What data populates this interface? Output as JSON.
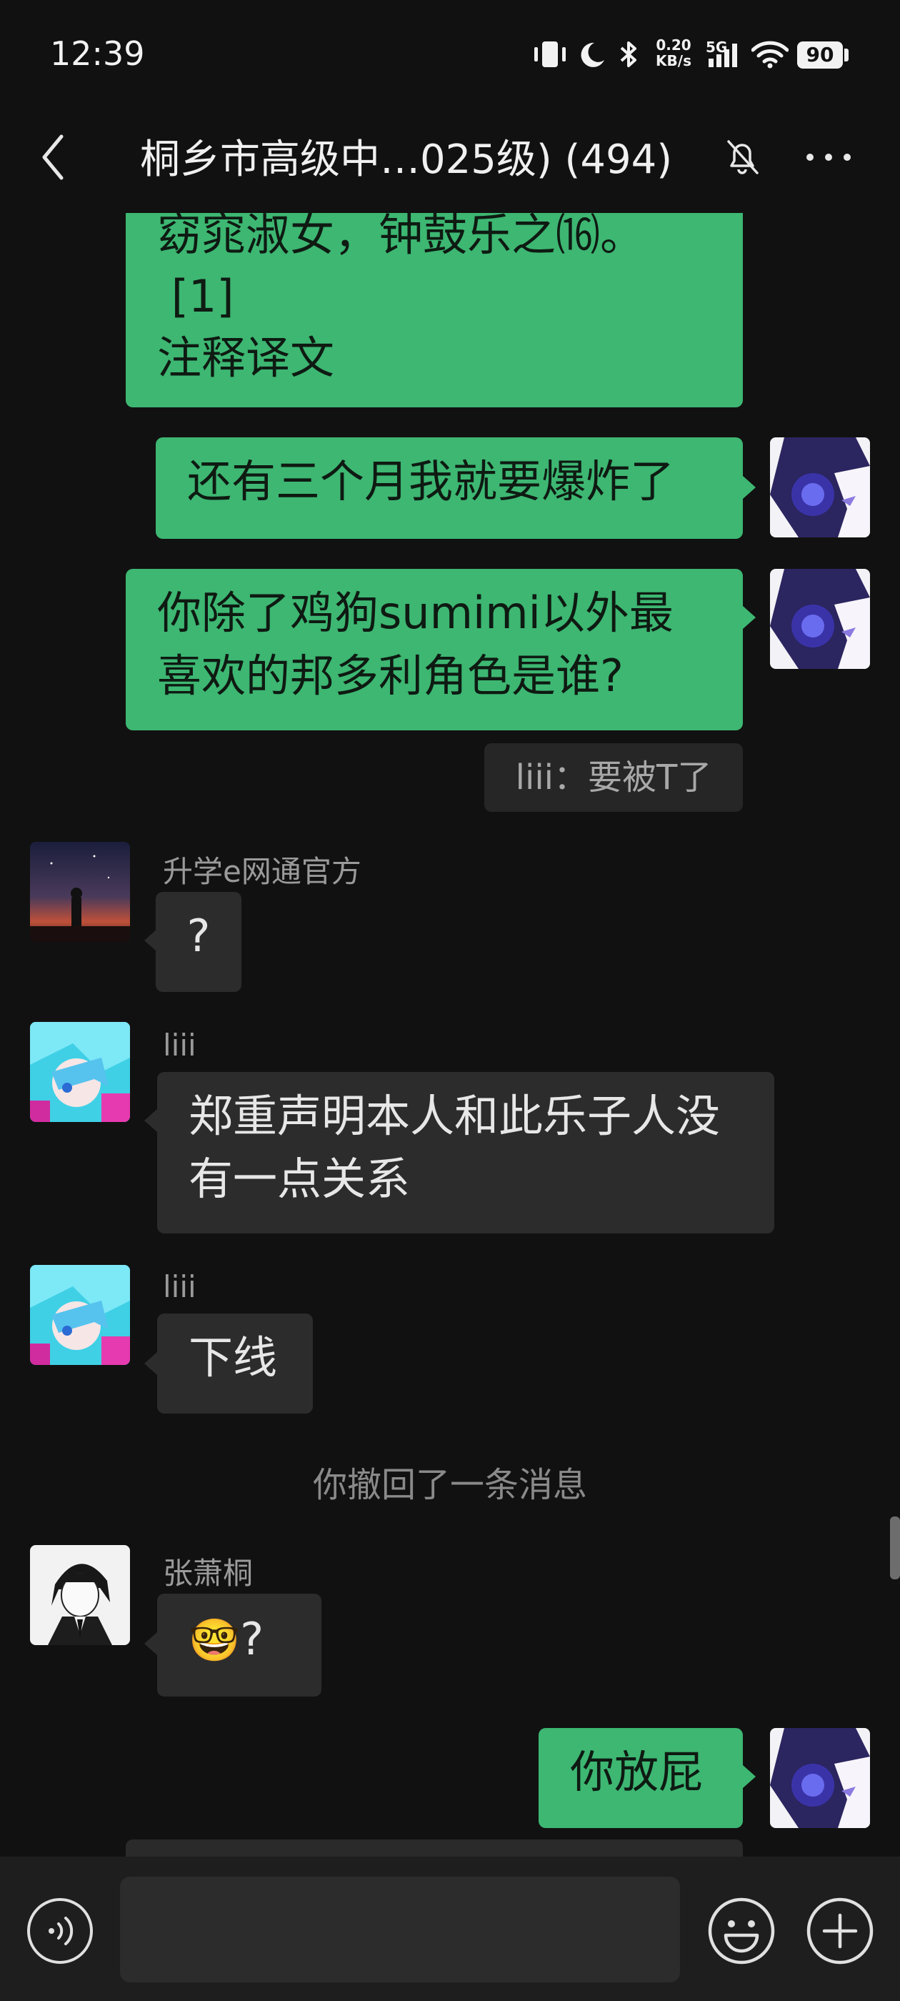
{
  "status_bar": {
    "time": "12:39",
    "net_speed_value": "0.20",
    "net_speed_unit": "KB/s",
    "network": "5G",
    "battery": "90"
  },
  "header": {
    "title": "桐乡市高级中…025级) (494)"
  },
  "messages": {
    "m1_lines": [
      "窈窕淑女，钟鼓乐之⒃。",
      " [1]",
      "注释译文"
    ],
    "m2": "还有三个月我就要爆炸了",
    "m3": "你除了鸡狗sumimi以外最喜欢的邦多利角色是谁?",
    "m4": "liii：要被T了",
    "m5_sender": "升学e网通官方",
    "m5": "?",
    "m6_sender": "liii",
    "m6": "郑重声明本人和此乐子人没有一点关系",
    "m7_sender": "liii",
    "m7": "下线",
    "system": "你撤回了一条消息",
    "m8_sender": "张萧桐",
    "m8_emoji": "🤓",
    "m8": "?",
    "m9": "你放屁"
  },
  "input": {
    "placeholder": ""
  },
  "icons": {
    "back": "chevron-left-icon",
    "mute": "bell-off-icon",
    "more": "more-horizontal-icon",
    "voice": "voice-icon",
    "emoji": "smiley-icon",
    "plus": "plus-icon"
  },
  "colors": {
    "background": "#111111",
    "outgoing_bubble": "#3db772",
    "incoming_bubble": "#2c2c2c"
  }
}
